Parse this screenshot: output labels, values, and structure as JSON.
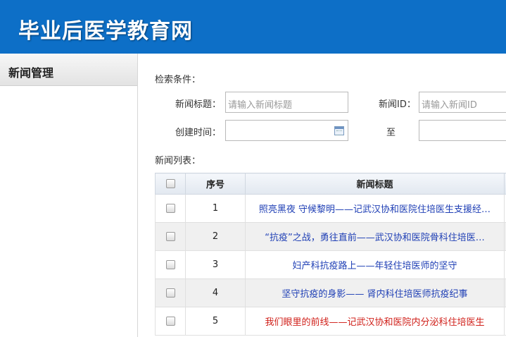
{
  "header": {
    "title": "毕业后医学教育网"
  },
  "sidebar": {
    "items": [
      {
        "label": "新闻管理"
      }
    ]
  },
  "search": {
    "section_label": "检索条件：",
    "title_label": "新闻标题：",
    "title_placeholder": "请输入新闻标题",
    "id_label": "新闻ID：",
    "id_placeholder": "请输入新闻ID",
    "created_label": "创建时间：",
    "to_label": "至"
  },
  "list": {
    "section_label": "新闻列表：",
    "columns": {
      "checkbox": "",
      "no": "序号",
      "title": "新闻标题"
    },
    "rows": [
      {
        "no": "1",
        "title": "照亮黑夜 守候黎明——记武汉协和医院住培医生支援经…",
        "color": "#1f3fb5"
      },
      {
        "no": "2",
        "title": "“抗疫”之战，勇往直前——武汉协和医院骨科住培医…",
        "color": "#1f3fb5"
      },
      {
        "no": "3",
        "title": "妇产科抗疫路上——年轻住培医师的坚守",
        "color": "#1f3fb5"
      },
      {
        "no": "4",
        "title": "坚守抗疫的身影—— 肾内科住培医师抗疫纪事",
        "color": "#1f3fb5"
      },
      {
        "no": "5",
        "title": "我们眼里的前线——记武汉协和医院内分泌科住培医生",
        "color": "#d0201a"
      }
    ]
  },
  "colors": {
    "header_bg": "#0d6fc7",
    "link_blue": "#1f3fb5",
    "link_red": "#d0201a"
  }
}
